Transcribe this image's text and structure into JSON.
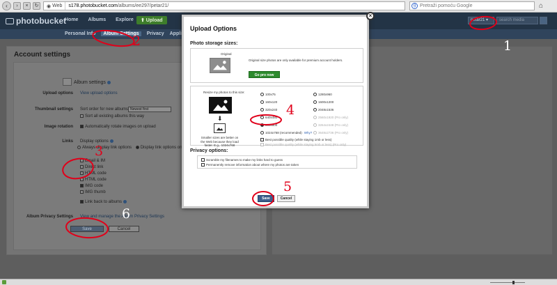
{
  "browser": {
    "site_label": "Web",
    "url_host": "s178.photobucket.com",
    "url_path": "/albums/ee297/petar21/",
    "search_placeholder": "Pretraži pomoću Google",
    "search_engine_icon": "google-icon",
    "home_icon": "home-icon"
  },
  "header": {
    "logo": "photobucket",
    "nav": [
      "Home",
      "Albums",
      "Explore"
    ],
    "upload_label": "⬆ Upload",
    "user_label": "petar21 ▾",
    "search_placeholder": "search media"
  },
  "subnav": {
    "items": [
      "Personal Info",
      "Album Settings",
      "Privacy",
      "Applications"
    ],
    "active_index": 1
  },
  "settings": {
    "title": "Account settings",
    "album_settings_label": "Album settings",
    "rows": {
      "upload_options_label": "Upload options",
      "upload_options_link": "View upload options",
      "thumbnail_label": "Thumbnail settings",
      "thumbnail_sort_text": "Sort order for new albums",
      "thumbnail_sort_value": "Newest first",
      "thumbnail_sort_all": "Sort all existing albums this way",
      "image_rotation_label": "Image rotation",
      "image_rotation_text": "Automatically rotate images on upload",
      "links_label": "Links",
      "display_options_text": "Display options",
      "display_always": "Always display link options",
      "display_mouseover": "Display link options on mouseover",
      "link_types": [
        "Email & IM",
        "Direct link",
        "HTML code",
        "HTML code",
        "IMG code",
        "IMG thumb"
      ],
      "link_back": "Link back to albums",
      "privacy_label": "Album Privacy Settings",
      "privacy_link": "View and manage the Album Privacy Settings"
    },
    "save_label": "Save",
    "cancel_label": "Cancel"
  },
  "modal": {
    "title": "Upload Options",
    "storage_label": "Photo storage sizes:",
    "original_label": "Original",
    "original_desc": "Original size photos are only available for premium account holders.",
    "go_pro_label": "Go pro now",
    "resize_label": "Resize my photos to this size:",
    "resize_help": "Smaller sizes are better on the Web because they load faster. E.g., 1024x768",
    "sizes_left": [
      "100x75",
      "160x120",
      "320x240",
      "640x480",
      "800x600",
      "1024x768 (recommended)"
    ],
    "sizes_right": [
      "1280x960",
      "1600x1200",
      "2048x1536",
      "2560x1920 (Pro only)",
      "3264x2448 (Pro only)",
      "3648x2736 (Pro only)"
    ],
    "why_link": "Why?",
    "selected_size": "800x600",
    "quality_best": "Best possible quality (while staying 1mb or less)",
    "quality_pro": "Best possible quality (while staying 5mb or less) (Pro only)",
    "privacy_label": "Privacy options:",
    "privacy_opts": [
      "Scramble my filenames to make my links hard to guess",
      "Permanently remove information about where my photos are taken"
    ],
    "save_label": "Save",
    "cancel_label": "Cancel"
  },
  "annotations": [
    "1",
    "2",
    "3",
    "4",
    "5",
    "6"
  ],
  "colors": {
    "annotation": "#e0001a",
    "header_bg": "#233446",
    "modal_save": "#3c5e8c",
    "go_pro": "#2e8b2e"
  }
}
